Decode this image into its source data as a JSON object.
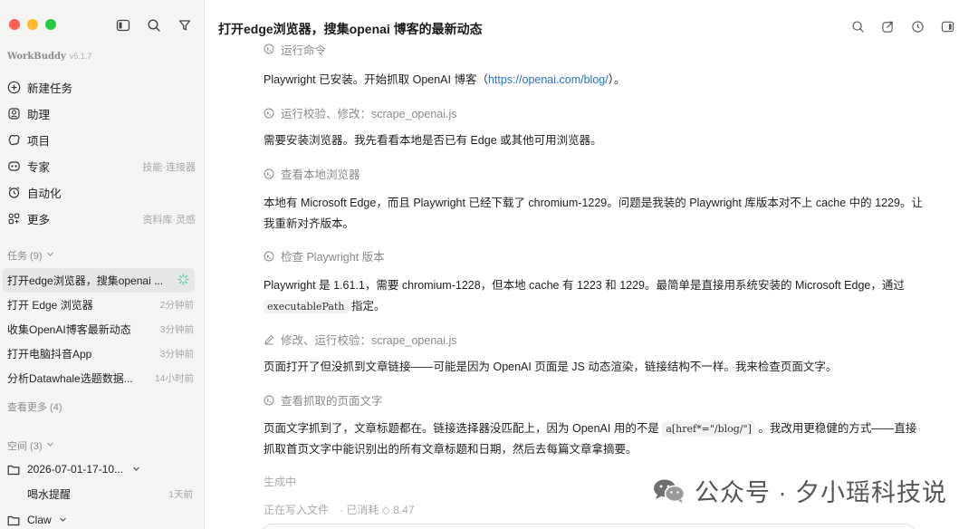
{
  "colors": {
    "traffic_red": "#ff5f57",
    "traffic_yellow": "#febc2e",
    "traffic_green": "#28c840",
    "link": "#2b6fc6",
    "sidebar_bg": "#f4f4f3"
  },
  "sidebar": {
    "brand": "WorkBuddy",
    "version": "v5.1.7",
    "tools": [
      "sidebar-toggle-icon",
      "search-icon",
      "filter-icon"
    ],
    "nav": [
      {
        "label": "新建任务",
        "hint": "",
        "icon": "plus-circle-icon"
      },
      {
        "label": "助理",
        "hint": "",
        "icon": "assistant-icon"
      },
      {
        "label": "项目",
        "hint": "",
        "icon": "project-icon"
      },
      {
        "label": "专家",
        "hint": "技能·连接器",
        "icon": "expert-icon"
      },
      {
        "label": "自动化",
        "hint": "",
        "icon": "alarm-clock-icon"
      },
      {
        "label": "更多",
        "hint": "资料库·灵感",
        "icon": "grid-icon"
      }
    ],
    "tasks_header": "任务 (9)",
    "tasks": [
      {
        "title": "打开edge浏览器，搜集openai ...",
        "time": ""
      },
      {
        "title": "打开 Edge 浏览器",
        "time": "2分钟前"
      },
      {
        "title": "收集OpenAI博客最新动态",
        "time": "3分钟前"
      },
      {
        "title": "打开电脑抖音App",
        "time": "3分钟前"
      },
      {
        "title": "分析Datawhale选题数据...",
        "time": "14小时前"
      }
    ],
    "see_more": "查看更多 (4)",
    "spaces_header": "空间 (3)",
    "spaces": [
      {
        "label": "2026-07-01-17-10...",
        "time": ""
      },
      {
        "label": "喝水提醒",
        "time": "1天前"
      },
      {
        "label": "Claw",
        "time": ""
      }
    ]
  },
  "main": {
    "title": "打开edge浏览器，搜集openai 博客的最新动态",
    "top_icons": [
      "search-icon",
      "share-icon",
      "history-icon",
      "panel-icon"
    ],
    "steps": {
      "s0": "运行命令",
      "s1": "运行校验、修改：scrape_openai.js",
      "s2": "查看本地浏览器",
      "s3": "检查 Playwright 版本",
      "s4": "修改、运行校验：scrape_openai.js",
      "s5": "查看抓取的页面文字"
    },
    "paras": {
      "p1a": "Playwright 已安装。开始抓取 OpenAI 博客（",
      "p1link": "https://openai.com/blog/",
      "p1b": "）。",
      "p2": "需要安装浏览器。我先看看本地是否已有 Edge 或其他可用浏览器。",
      "p3": "本地有 Microsoft Edge，而且 Playwright 已经下载了 chromium-1229。问题是我装的 Playwright 库版本对不上 cache 中的 1229。让我重新对齐版本。",
      "p4a": "Playwright 是 1.61.1，需要 chromium-1228，但本地 cache 有 1223 和 1229。最简单是直接用系统安装的 Microsoft Edge，通过",
      "p4code": "executablePath",
      "p4b": "指定。",
      "p5": "页面打开了但没抓到文章链接——可能是因为 OpenAI 页面是 JS 动态渲染，链接结构不一样。我来检查页面文字。",
      "p6a": "页面文字抓到了，文章标题都在。链接选择器没匹配上，因为 OpenAI 用的不是",
      "p6code": "a[href*=\"/blog/\"]",
      "p6b": "。我改用更稳健的方式——直接抓取首页文字中能识别出的所有文章标题和日期，然后去每篇文章拿摘要。"
    },
    "generating": "生成中",
    "status_writing": "正在写入文件",
    "status_cost": "· 已消耗 ◇ 8.47",
    "watermark": "公众号 · 夕小瑶科技说"
  }
}
